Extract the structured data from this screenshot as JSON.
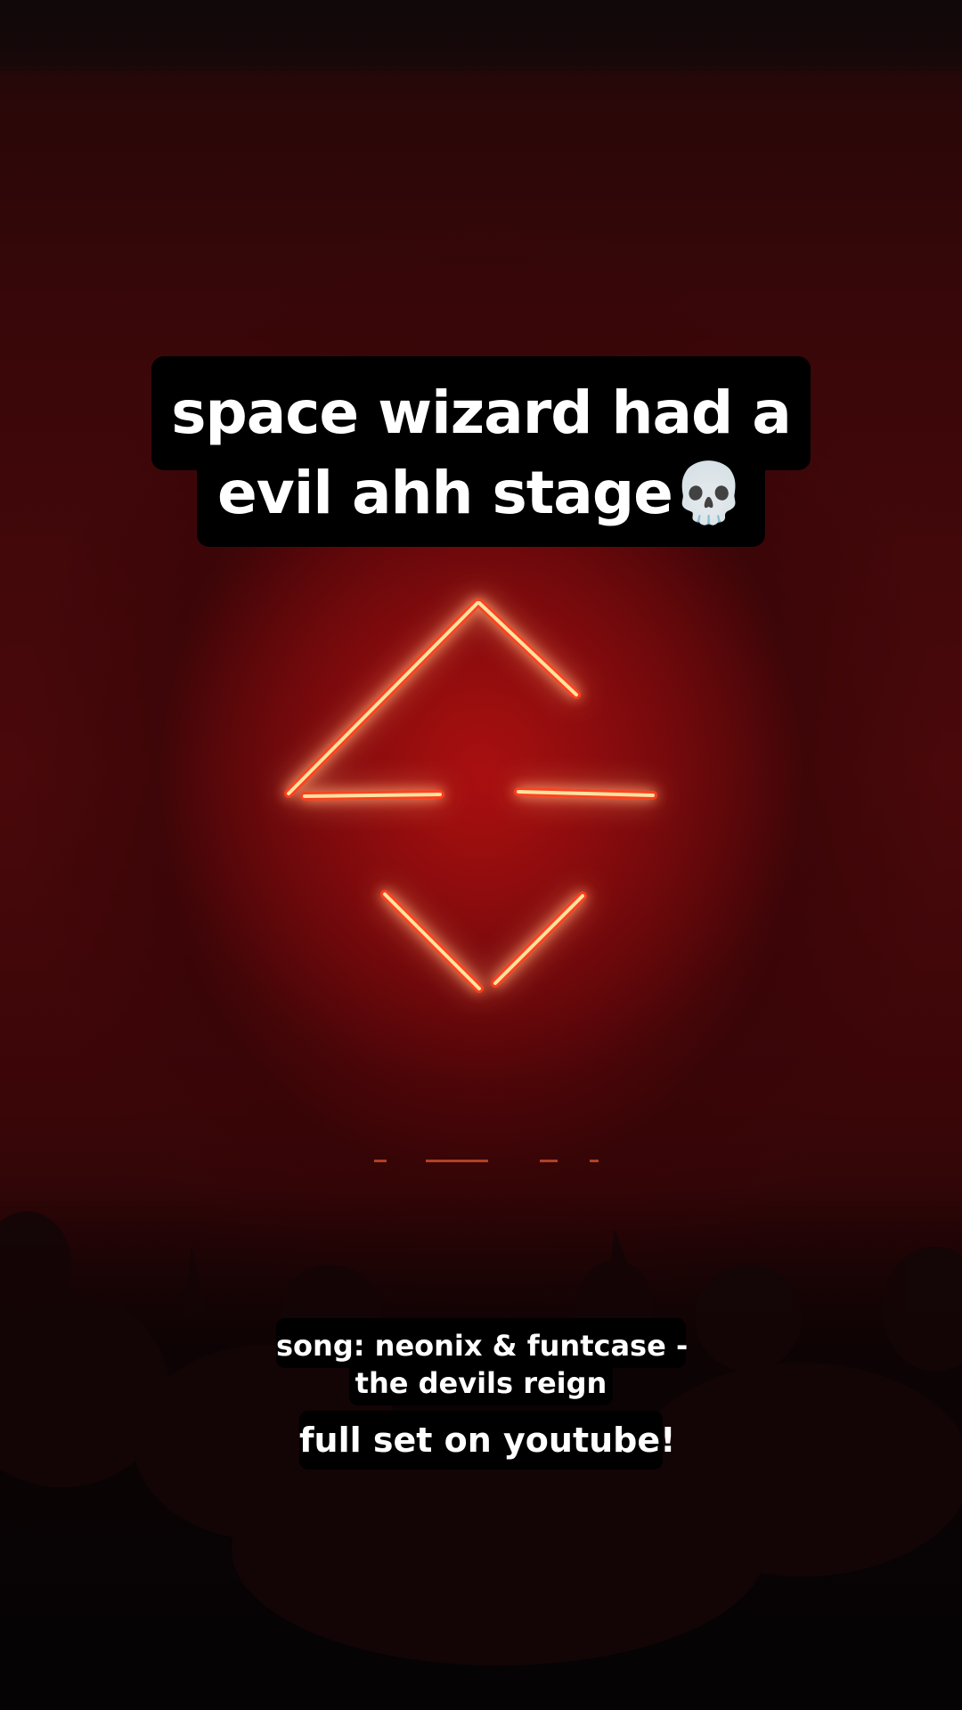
{
  "overlay": {
    "title_line_1": "space wizard had a",
    "title_line_2": "evil ahh stage💀",
    "song_line_1": "song: neonix & funtcase -",
    "song_line_2": "the devils reign",
    "cta": "full set on youtube!"
  },
  "colors": {
    "caption_background": "#000000",
    "caption_text": "#ffffff",
    "neon": "#ffd27a",
    "neon_glow": "#ff2a10",
    "stage_red": "#8a0a0c"
  }
}
